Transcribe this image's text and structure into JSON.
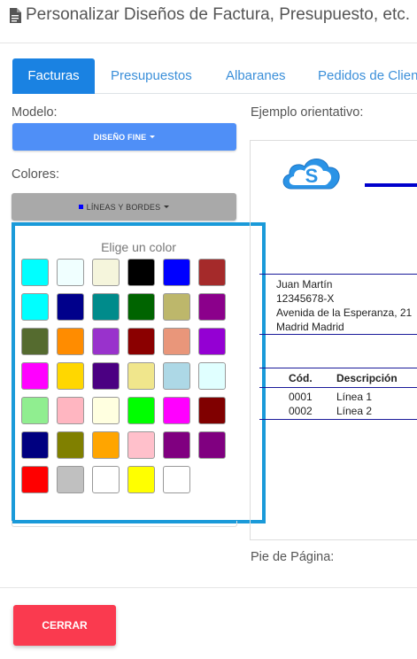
{
  "header": {
    "title": "Personalizar Diseños de Factura, Presupuesto, etc."
  },
  "tabs": [
    {
      "label": "Facturas",
      "active": true
    },
    {
      "label": "Presupuestos",
      "active": false
    },
    {
      "label": "Albaranes",
      "active": false
    },
    {
      "label": "Pedidos de Clientes",
      "active": false
    }
  ],
  "form": {
    "model_label": "Modelo:",
    "model_button": "DISEÑO FINE",
    "colors_label": "Colores:",
    "colors_button": "LÍNEAS Y BORDES",
    "colors_button_swatch": "#0000ff"
  },
  "color_picker": {
    "title": "Elige un color",
    "colors": [
      "#00ffff",
      "#f0ffff",
      "#f5f5dc",
      "#000000",
      "#0000ff",
      "#a52a2a",
      "#00ffff",
      "#00008b",
      "#008b8b",
      "#006400",
      "#bdb76b",
      "#8b008b",
      "#556b2f",
      "#ff8c00",
      "#9932cc",
      "#8b0000",
      "#e9967a",
      "#9400d3",
      "#ff00ff",
      "#ffd700",
      "#4b0082",
      "#f0e68c",
      "#add8e6",
      "#e0ffff",
      "#90ee90",
      "#ffb6c1",
      "#ffffe0",
      "#00ff00",
      "#ff00ff",
      "#800000",
      "#000080",
      "#808000",
      "#ffa500",
      "#ffc0cb",
      "#800080",
      "#800080",
      "#ff0000",
      "#c0c0c0",
      "#ffffff",
      "#ffff00",
      "#ffffff"
    ]
  },
  "preview": {
    "label": "Ejemplo orientativo:",
    "client": {
      "name": "Juan Martín",
      "tax_id": "12345678-X",
      "address": "Avenida de la Esperanza, 21",
      "city": "Madrid Madrid"
    },
    "table": {
      "headers": [
        "Cód.",
        "Descripción"
      ],
      "rows": [
        [
          "0001",
          "Línea 1"
        ],
        [
          "0002",
          "Línea 2"
        ]
      ]
    },
    "footer_label": "Pie de Página:"
  },
  "footer": {
    "close_button": "CERRAR"
  },
  "colors": {
    "accent": "#1a82e2",
    "danger": "#fa3a4f",
    "line": "#0000cc"
  }
}
